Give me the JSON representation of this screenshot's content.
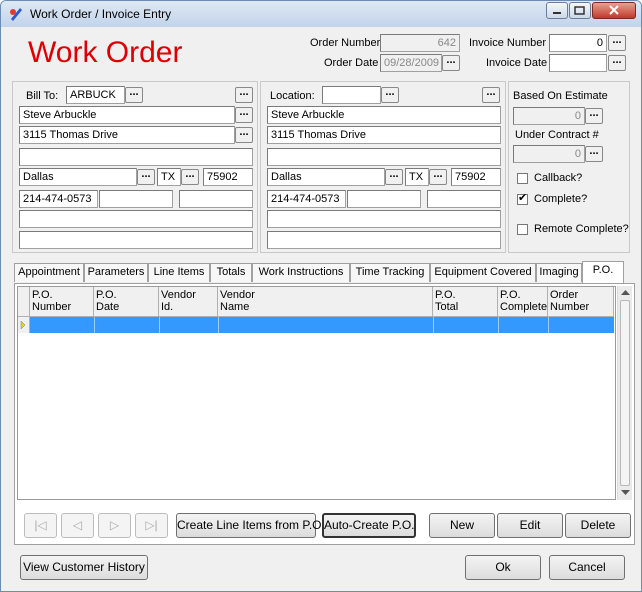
{
  "window": {
    "title": "Work Order /  Invoice Entry"
  },
  "header": {
    "big_title": "Work Order",
    "order_number_label": "Order Number",
    "order_number": "642",
    "order_date_label": "Order Date",
    "order_date": "09/28/2009",
    "invoice_number_label": "Invoice Number",
    "invoice_number": "0",
    "invoice_date_label": "Invoice Date",
    "invoice_date": ""
  },
  "bill_to": {
    "label": "Bill To:",
    "code": "ARBUCK",
    "name": "Steve Arbuckle",
    "address1": "3115 Thomas Drive",
    "address2": "",
    "city": "Dallas",
    "state": "TX",
    "zip": "75902",
    "phone": "214-474-0573",
    "phone2": "",
    "phone3": "",
    "extra1": "",
    "extra2": ""
  },
  "location": {
    "label": "Location:",
    "code": "",
    "name": "Steve Arbuckle",
    "address1": "3115 Thomas Drive",
    "address2": "",
    "city": "Dallas",
    "state": "TX",
    "zip": "75902",
    "phone": "214-474-0573",
    "phone2": "",
    "phone3": "",
    "extra1": "",
    "extra2": ""
  },
  "estimate": {
    "based_on_label": "Based On Estimate",
    "based_on_value": "0",
    "under_contract_label": "Under Contract #",
    "under_contract_value": "0"
  },
  "checks": {
    "callback_label": "Callback?",
    "callback": false,
    "complete_label": "Complete?",
    "complete": true,
    "remote_label": "Remote Complete?",
    "remote": false
  },
  "tabs": [
    "Appointment",
    "Parameters",
    "Line Items",
    "Totals",
    "Work Instructions",
    "Time Tracking",
    "Equipment Covered",
    "Imaging",
    "P.O."
  ],
  "active_tab": "P.O.",
  "po_grid": {
    "columns": [
      {
        "line1": "P.O.",
        "line2": "Number"
      },
      {
        "line1": "P.O.",
        "line2": "Date"
      },
      {
        "line1": "Vendor",
        "line2": "Id."
      },
      {
        "line1": "Vendor",
        "line2": "Name"
      },
      {
        "line1": "P.O.",
        "line2": "Total"
      },
      {
        "line1": "P.O.",
        "line2": "Complete"
      },
      {
        "line1": "Order",
        "line2": "Number"
      }
    ]
  },
  "po_buttons": {
    "create_line_items": "Create Line Items from P.O.",
    "auto_create": "Auto-Create P.O.",
    "new": "New",
    "edit": "Edit",
    "delete": "Delete"
  },
  "footer": {
    "view_history": "View Customer History",
    "ok": "Ok",
    "cancel": "Cancel"
  },
  "colors": {
    "title_red": "#e00000",
    "selection_blue": "#3399ff"
  },
  "icons": [
    "app-icon",
    "minimize-icon",
    "restore-icon",
    "close-icon",
    "lookup-dots-icon",
    "record-first-icon",
    "record-prev-icon",
    "record-next-icon",
    "record-last-icon",
    "current-row-icon"
  ]
}
